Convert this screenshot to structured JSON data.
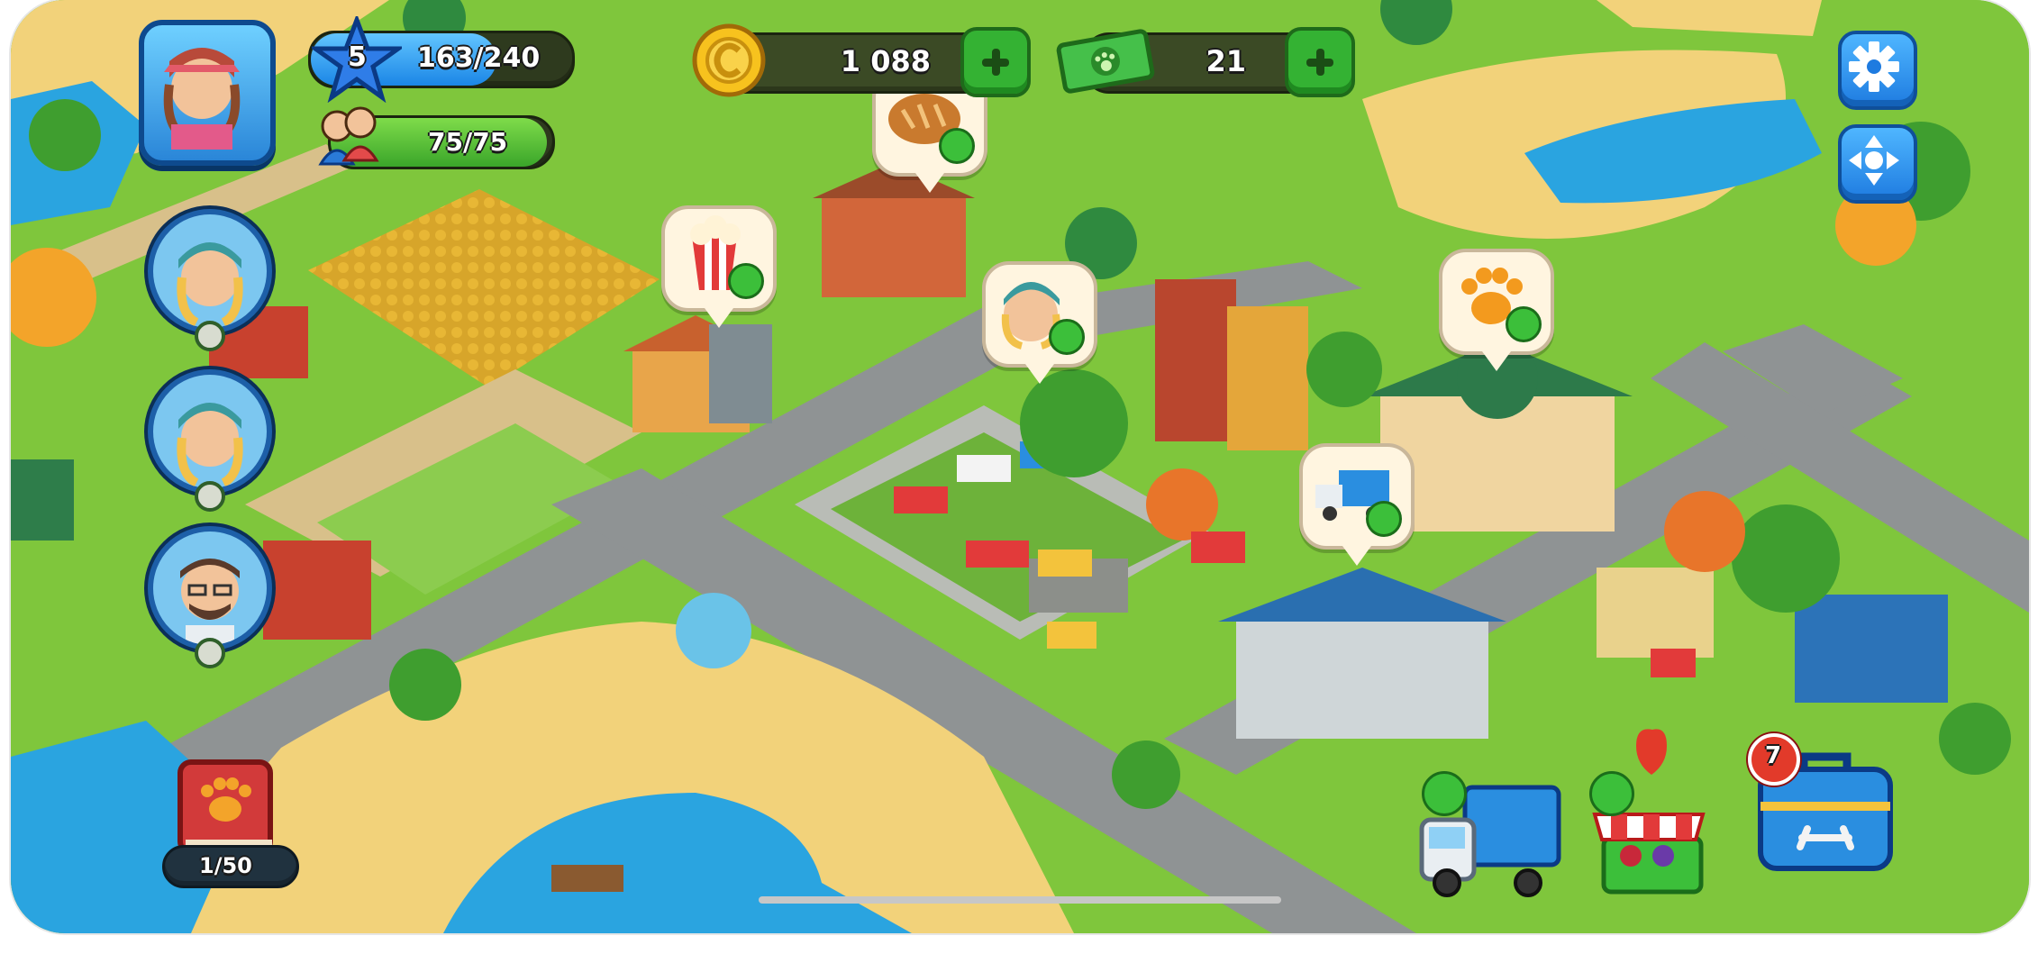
{
  "player": {
    "level": "5",
    "xp": "163/240",
    "population": "75/75"
  },
  "currency": {
    "coins": "1 088",
    "cash": "21"
  },
  "album": {
    "progress": "1/50"
  },
  "toolbox": {
    "badge": "7"
  },
  "icons": {
    "settings": "gear-icon",
    "move": "move-arrows-icon",
    "coin": "coin-icon",
    "cash": "cash-icon",
    "level_star": "star-icon",
    "population": "people-icon",
    "album": "paw-book-icon",
    "toolbox": "toolbox-icon"
  },
  "colors": {
    "grass": "#7fc63c",
    "road": "#8f9394",
    "water": "#2aa4e0",
    "sand": "#f2d27a",
    "hud_green": "#34b233",
    "hud_blue": "#1e7be0"
  }
}
